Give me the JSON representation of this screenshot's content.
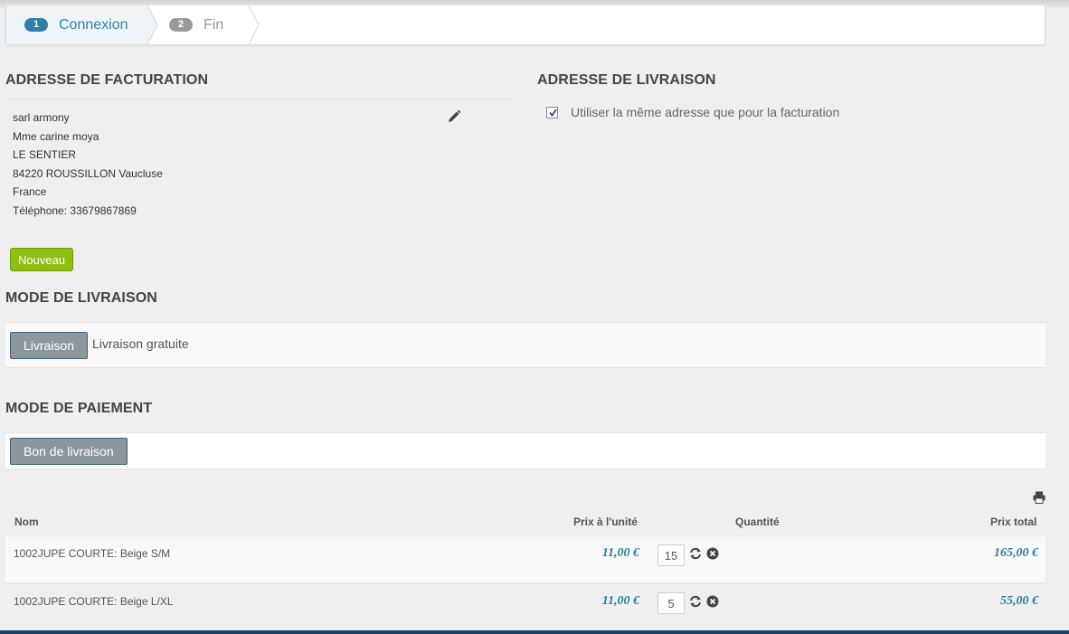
{
  "steps": [
    {
      "num": "1",
      "label": "Connexion"
    },
    {
      "num": "2",
      "label": "Fin"
    }
  ],
  "billing": {
    "title": "ADRESSE DE FACTURATION",
    "lines": [
      "sarl armony",
      "Mme carine moya",
      "LE SENTIER",
      "84220 ROUSSILLON Vaucluse",
      "France",
      "Téléphone: 33679867869"
    ],
    "new_label": "Nouveau"
  },
  "shipping_address": {
    "title": "ADRESSE DE LIVRAISON",
    "same_label": "Utiliser la même adresse que pour la facturation"
  },
  "delivery": {
    "title": "MODE DE LIVRAISON",
    "button": "Livraison",
    "text": "Livraison gratuite"
  },
  "payment": {
    "title": "MODE DE PAIEMENT",
    "button": "Bon de livraison"
  },
  "table": {
    "headers": {
      "name": "Nom",
      "unit": "Prix à l'unité",
      "qty": "Quantité",
      "total": "Prix total"
    },
    "rows": [
      {
        "name": "1002JUPE COURTE: Beige S/M",
        "unit": "11,00 €",
        "qty": "15",
        "total": "165,00 €"
      },
      {
        "name": "1002JUPE COURTE: Beige L/XL",
        "unit": "11,00 €",
        "qty": "5",
        "total": "55,00 €"
      }
    ]
  },
  "icons": {
    "edit": "pencil-icon",
    "print": "print-icon",
    "refresh": "refresh-icon",
    "remove": "remove-icon"
  },
  "colors": {
    "accent": "#2e86a8",
    "green": "#8fbf13",
    "price": "#2e7f98"
  }
}
